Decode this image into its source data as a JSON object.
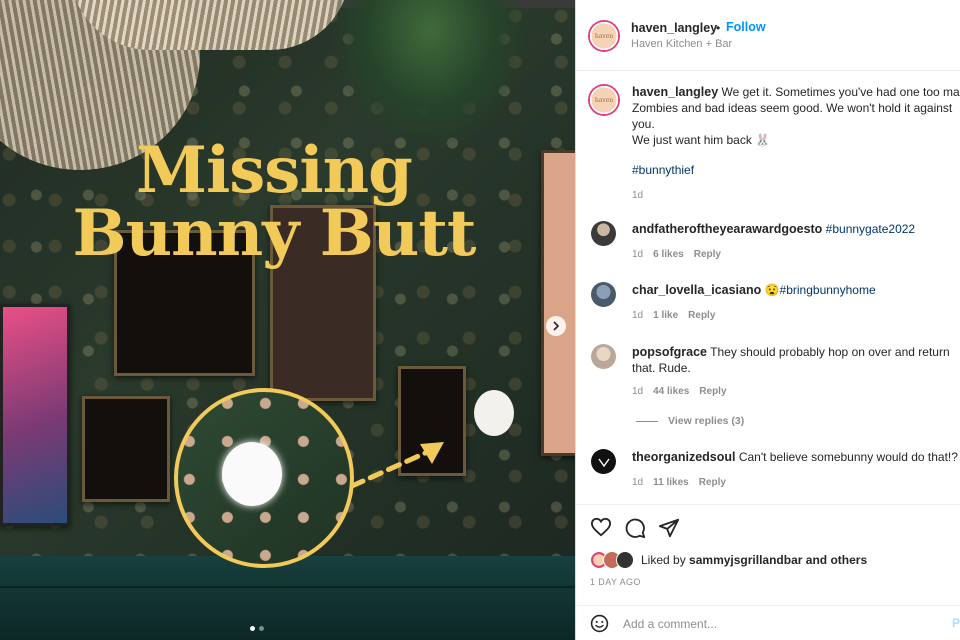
{
  "post_image": {
    "headline_line1": "Missing",
    "headline_line2": "Bunny Butt",
    "carousel_pages": 2,
    "carousel_current": 1
  },
  "header": {
    "username": "haven_langley",
    "bullet": "•",
    "follow_label": "Follow",
    "subtitle": "Haven Kitchen + Bar"
  },
  "caption": {
    "username": "haven_langley",
    "line1": "We get it. Sometimes you've had one too many",
    "line2": "Zombies and bad ideas seem good. We won't hold it against",
    "line3": "you.",
    "line4": "We just want him back 🐰",
    "hashtag": "#bunnythief",
    "time": "1d"
  },
  "comments": [
    {
      "username": "andfatheroftheyearawardgoesto",
      "text": "",
      "hashtag": "#bunnygate2022",
      "time": "1d",
      "likes": "6 likes",
      "reply": "Reply"
    },
    {
      "username": "char_lovella_icasiano",
      "text": "😧",
      "hashtag": "#bringbunnyhome",
      "time": "1d",
      "likes": "1 like",
      "reply": "Reply"
    },
    {
      "username": "popsofgrace",
      "text": "They should probably hop on over and return",
      "text2": "that. Rude.",
      "hashtag": "",
      "time": "1d",
      "likes": "44 likes",
      "reply": "Reply"
    },
    {
      "username": "theorganizedsoul",
      "text": "Can't believe somebunny would do that!?",
      "hashtag": "",
      "time": "1d",
      "likes": "11 likes",
      "reply": "Reply"
    }
  ],
  "view_replies": "View replies (3)",
  "likes": {
    "prefix": "Liked by",
    "user": "sammyjsgrillandbar",
    "suffix": "and others"
  },
  "posted_ago": "1 DAY AGO",
  "add_comment": {
    "placeholder": "Add a comment...",
    "post_label": "P"
  },
  "colors": {
    "accent_blue": "#0095f6",
    "headline_gold": "#f1ca5a",
    "hashtag": "#00376b"
  }
}
